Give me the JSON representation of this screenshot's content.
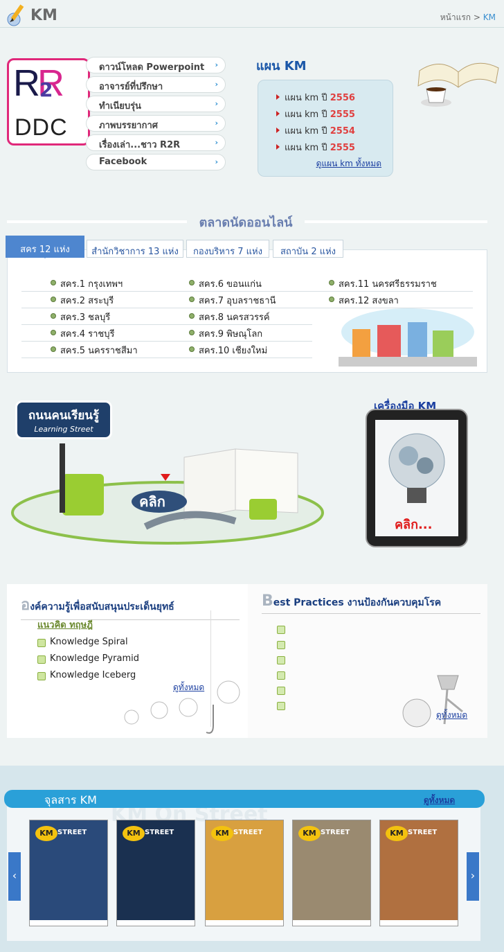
{
  "header": {
    "title": "KM",
    "breadcrumb": {
      "home": "หน้าแรก",
      "sep": ">",
      "current": "KM"
    }
  },
  "r2r_logo": {
    "r1": "R",
    "two": "2",
    "r2": "R",
    "ddc": "DDC"
  },
  "menu": [
    "ดาวน์โหลด Powerpoint",
    "อาจารย์ที่ปรึกษา",
    "ทำเนียบรุ่น",
    "ภาพบรรยากาศ",
    "เรื่องเล่า...ชาว R2R",
    "Facebook"
  ],
  "plan": {
    "title": "แผน KM",
    "items": [
      {
        "label": "แผน km ปี",
        "year": "2556"
      },
      {
        "label": "แผน km ปี",
        "year": "2555"
      },
      {
        "label": "แผน km ปี",
        "year": "2554"
      },
      {
        "label": "แผน km ปี",
        "year": "2555"
      }
    ],
    "all_link": "ดูแผน km ทั้งหมด"
  },
  "market": {
    "title": "ตลาดนัดออนไลน์",
    "tabs": [
      "สคร 12 แห่ง",
      "สำนักวิชาการ 13 แห่ง",
      "กองบริหาร 7 แห่ง",
      "สถาบัน 2 แห่ง"
    ],
    "col1": [
      "สคร.1 กรุงเทพฯ",
      "สคร.2 สระบุรี",
      "สคร.3 ชลบุรี",
      "สคร.4 ราชบุรี",
      "สคร.5 นครราชสีมา"
    ],
    "col2": [
      "สคร.6 ขอนแก่น",
      "สคร.7 อุบลราชธานี",
      "สคร.8 นครสวรรค์",
      "สคร.9 พิษณุโลก",
      "สคร.10 เชียงใหม่"
    ],
    "col3": [
      "สคร.11 นครศรีธรรมราช",
      "สคร.12 สงขลา"
    ]
  },
  "street": {
    "sign_th": "ถนนคนเรียนรู้",
    "sign_en": "Learning Street",
    "click": "คลิก"
  },
  "tools": {
    "title": "เครื่องมือ KM",
    "click": "คลิก..."
  },
  "knowledge": {
    "cap": "อ",
    "title_rest": "งค์ความรู้เพื่อสนับสนุนประเด็นยุทธ์",
    "sub": "แนวคิด ทฤษฎี",
    "items": [
      "Knowledge Spiral",
      "Knowledge Pyramid",
      "Knowledge Iceberg"
    ],
    "more": "ดูทั้งหมด"
  },
  "best": {
    "cap": "B",
    "title_rest": "est Practices งานป้องกันควบคุมโรค",
    "more": "ดูทั้งหมด",
    "bullets": 6
  },
  "journal": {
    "title": "จุลสาร KM",
    "all": "ดูทั้งหมด",
    "watermark": "KM On Street",
    "prev": "‹",
    "next": "›",
    "covers": [
      {
        "brand": "KM",
        "name": "STREET",
        "bg": "#2a4a7a"
      },
      {
        "brand": "KM",
        "name": "STREET",
        "bg": "#1a3050"
      },
      {
        "brand": "KM",
        "name": "STREET",
        "bg": "#d8a040"
      },
      {
        "brand": "KM",
        "name": "STREET",
        "bg": "#9a8a70"
      },
      {
        "brand": "KM",
        "name": "STREET",
        "bg": "#b07040"
      }
    ]
  },
  "colors": {
    "accent": "#4e86cf",
    "link": "#1b3fa0",
    "red": "#e04040"
  }
}
